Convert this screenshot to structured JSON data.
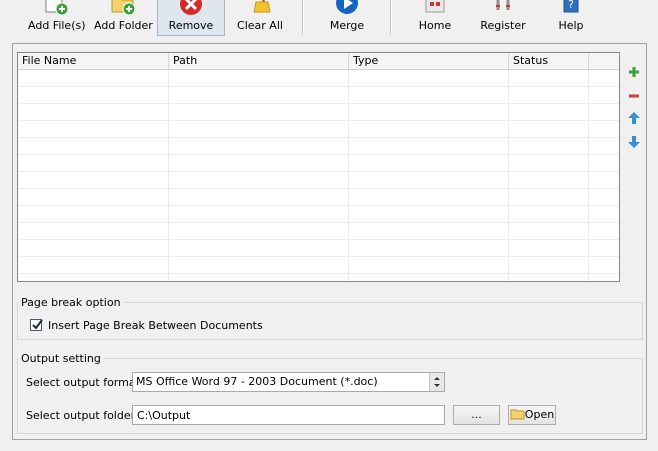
{
  "toolbar": {
    "add_files": "Add File(s)",
    "add_folder": "Add Folder",
    "remove": "Remove",
    "clear_all": "Clear All",
    "merge": "Merge",
    "home": "Home",
    "register": "Register",
    "help": "Help"
  },
  "file_list": {
    "columns": [
      "File Name",
      "Path",
      "Type",
      "Status"
    ],
    "rows": []
  },
  "page_break": {
    "group_title": "Page break option",
    "checkbox_label": "Insert Page Break Between Documents",
    "checked": true
  },
  "output": {
    "group_title": "Output setting",
    "format_label": "Select output format:",
    "format_value": "MS Office Word 97 - 2003 Document (*.doc)",
    "folder_label": "Select output folder:",
    "folder_value": "C:\\Output",
    "browse_label": "...",
    "open_label": "Open"
  },
  "colors": {
    "remove_red": "#d42a2a",
    "merge_blue": "#1565c0",
    "add_green": "#3aa13a",
    "side_minus_red": "#d43c3c",
    "side_arrow_blue": "#3a8fd0"
  }
}
